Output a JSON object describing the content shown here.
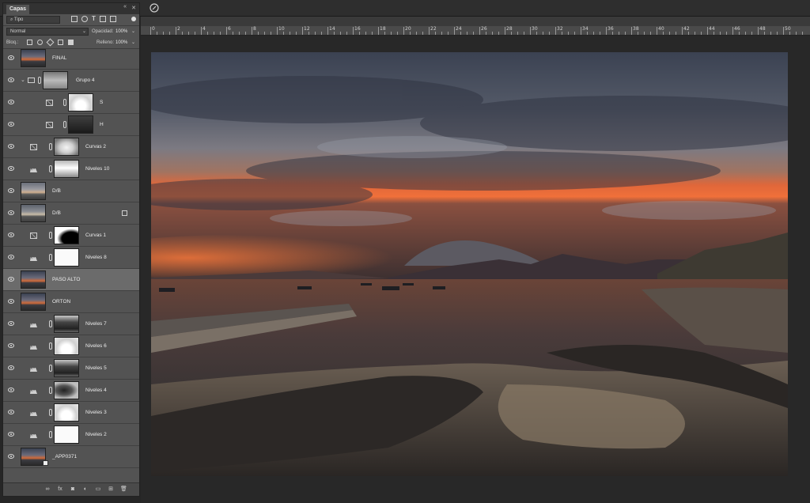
{
  "panel": {
    "tab_label": "Capas",
    "filter_value": "Tipo",
    "blend_mode": "Normal",
    "opacity_label": "Opacidad:",
    "opacity_value": "100%",
    "lock_label": "Bloq.:",
    "fill_label": "Relleno:",
    "fill_value": "100%"
  },
  "layers": [
    {
      "name": "FINAL",
      "kind": "pixel",
      "thumb": "photo-t"
    },
    {
      "name": "Grupo 4",
      "kind": "group",
      "thumb": "mask-group"
    },
    {
      "name": "S",
      "kind": "curves-mask",
      "indent": true,
      "thumb": "mask-niv2"
    },
    {
      "name": "H",
      "kind": "curves-mask",
      "indent": true,
      "thumb": "mask-dark"
    },
    {
      "name": "Curvas 2",
      "kind": "curves",
      "thumb": "mask-curve2"
    },
    {
      "name": "Niveles 10",
      "kind": "levels",
      "thumb": "mask-niv"
    },
    {
      "name": "D/B",
      "kind": "pixel",
      "thumb": "photo-db"
    },
    {
      "name": "D/B",
      "kind": "pixel-fx",
      "thumb": "photo-db2"
    },
    {
      "name": "Curvas 1",
      "kind": "curves",
      "thumb": "mask-curve1"
    },
    {
      "name": "Niveles 8",
      "kind": "levels",
      "thumb": "mask-white"
    },
    {
      "name": "PASO ALTO",
      "kind": "pixel",
      "thumb": "photo-t",
      "selected": true
    },
    {
      "name": "ORTON",
      "kind": "pixel",
      "thumb": "photo-t"
    },
    {
      "name": "Niveles 7",
      "kind": "levels",
      "thumb": "mask-niv3"
    },
    {
      "name": "Niveles 6",
      "kind": "levels",
      "thumb": "mask-niv2"
    },
    {
      "name": "Niveles 5",
      "kind": "levels",
      "thumb": "mask-niv3"
    },
    {
      "name": "Niveles 4",
      "kind": "levels",
      "thumb": "mask-niv4"
    },
    {
      "name": "Niveles 3",
      "kind": "levels",
      "thumb": "mask-niv2"
    },
    {
      "name": "Niveles 2",
      "kind": "levels",
      "thumb": "mask-white"
    },
    {
      "name": "_APP0371",
      "kind": "smart",
      "thumb": "photo-t"
    }
  ],
  "ruler": {
    "labels": [
      "0",
      "2",
      "4",
      "6",
      "8",
      "10",
      "12",
      "14",
      "16",
      "18",
      "20",
      "22",
      "24",
      "26",
      "28",
      "30",
      "32",
      "34",
      "36",
      "38",
      "40",
      "42",
      "44",
      "46",
      "48",
      "50"
    ]
  },
  "footer_icons": [
    "link-icon",
    "fx-icon",
    "mask-icon",
    "adjustment-icon",
    "folder-icon",
    "new-layer-icon",
    "trash-icon"
  ],
  "colors": {
    "panel_bg": "#535353",
    "selected_row": "#6b6b6b",
    "workspace": "#282828"
  }
}
